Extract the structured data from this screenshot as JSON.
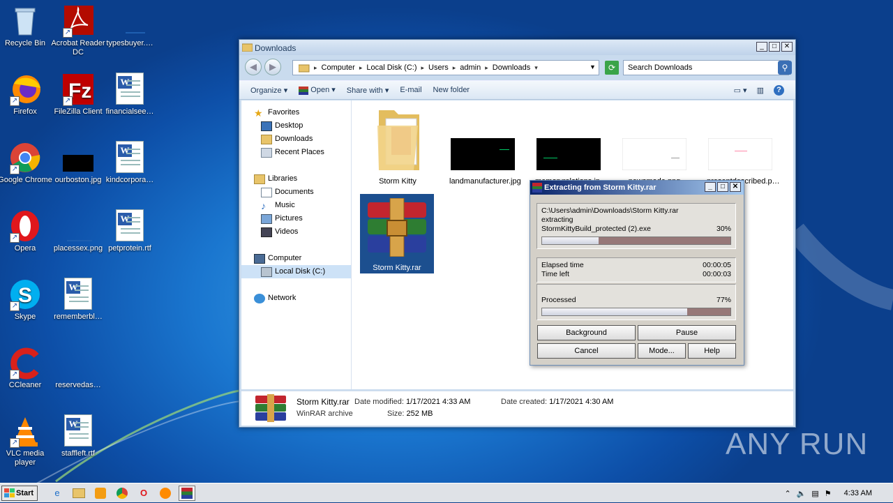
{
  "desktop": {
    "icons": [
      {
        "label": "Recycle Bin",
        "icon": "recycle-bin-icon"
      },
      {
        "label": "Acrobat Reader DC",
        "icon": "acrobat-icon"
      },
      {
        "label": "typesbuyer.…",
        "icon": "blank-file-icon"
      },
      {
        "label": "Firefox",
        "icon": "firefox-icon"
      },
      {
        "label": "FileZilla Client",
        "icon": "filezilla-icon"
      },
      {
        "label": "financialsee…",
        "icon": "word-doc-icon"
      },
      {
        "label": "Google Chrome",
        "icon": "chrome-icon"
      },
      {
        "label": "ourboston.jpg",
        "icon": "image-file-icon"
      },
      {
        "label": "kindcorpora…",
        "icon": "word-doc-icon"
      },
      {
        "label": "Opera",
        "icon": "opera-icon"
      },
      {
        "label": "placessex.png",
        "icon": "image-file-icon"
      },
      {
        "label": "petprotein.rtf",
        "icon": "word-doc-icon"
      },
      {
        "label": "Skype",
        "icon": "skype-icon"
      },
      {
        "label": "rememberbl…",
        "icon": "word-doc-icon"
      },
      {
        "label": "CCleaner",
        "icon": "ccleaner-icon"
      },
      {
        "label": "reservedas…",
        "icon": "blank-file-icon"
      },
      {
        "label": "VLC media player",
        "icon": "vlc-icon"
      },
      {
        "label": "staffleft.rtf",
        "icon": "word-doc-icon"
      }
    ]
  },
  "explorer": {
    "title": "Downloads",
    "breadcrumb": [
      "Computer",
      "Local Disk (C:)",
      "Users",
      "admin",
      "Downloads"
    ],
    "search_placeholder": "Search Downloads",
    "toolbar": {
      "organize": "Organize",
      "open": "Open",
      "share": "Share with",
      "email": "E-mail",
      "new_folder": "New folder"
    },
    "nav": {
      "favorites": "Favorites",
      "desktop": "Desktop",
      "downloads": "Downloads",
      "recent": "Recent Places",
      "libraries": "Libraries",
      "documents": "Documents",
      "music": "Music",
      "pictures": "Pictures",
      "videos": "Videos",
      "computer": "Computer",
      "local_disk": "Local Disk (C:)",
      "network": "Network"
    },
    "files": [
      {
        "name": "Storm Kitty",
        "type": "folder"
      },
      {
        "name": "landmanufacturer.jpg",
        "type": "image"
      },
      {
        "name": "memoryrelations.jp…",
        "type": "image"
      },
      {
        "name": "newsmade.png",
        "type": "image"
      },
      {
        "name": "presentdescribed.p…",
        "type": "image"
      },
      {
        "name": "Storm Kitty.rar",
        "type": "rar"
      }
    ],
    "details": {
      "name": "Storm Kitty.rar",
      "type": "WinRAR archive",
      "modified_label": "Date modified:",
      "modified": "1/17/2021 4:33 AM",
      "created_label": "Date created:",
      "created": "1/17/2021 4:30 AM",
      "size_label": "Size:",
      "size": "252 MB"
    }
  },
  "dialog": {
    "title": "Extracting from Storm Kitty.rar",
    "path": "C:\\Users\\admin\\Downloads\\Storm Kitty.rar",
    "action": "extracting",
    "file": "StormKittyBuild_protected (2).exe",
    "file_percent": "30%",
    "file_progress": 0.3,
    "elapsed_label": "Elapsed time",
    "elapsed": "00:00:05",
    "left_label": "Time left",
    "left": "00:00:03",
    "processed_label": "Processed",
    "processed_percent": "77%",
    "processed_progress": 0.77,
    "buttons": {
      "background": "Background",
      "pause": "Pause",
      "cancel": "Cancel",
      "mode": "Mode...",
      "help": "Help"
    }
  },
  "taskbar": {
    "start": "Start",
    "time": "4:33 AM"
  },
  "watermark": "ANY RUN"
}
